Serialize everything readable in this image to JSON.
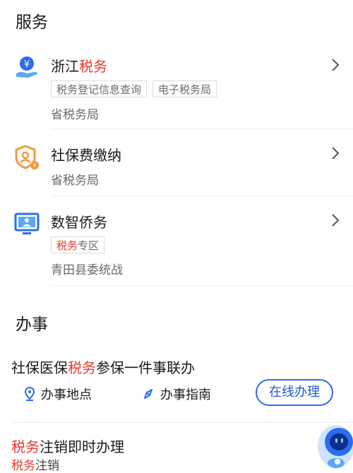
{
  "sections": {
    "services_title": "服务",
    "tasks_title": "办事"
  },
  "services": [
    {
      "name_plain": "浙江",
      "name_highlight": "税务",
      "tags": [
        {
          "highlight": "",
          "text": "税务登记信息查询"
        },
        {
          "highlight": "",
          "text": "电子税务局"
        }
      ],
      "provider": "省税务局",
      "icon": "tax-hand-icon"
    },
    {
      "name_plain": "社保费缴纳",
      "name_highlight": "",
      "tags": [],
      "provider": "省税务局",
      "icon": "social-security-shield-icon"
    },
    {
      "name_plain": "数智侨务",
      "name_highlight": "",
      "tags": [
        {
          "highlight": "税务",
          "text": "专区"
        }
      ],
      "provider": "青田县委统战",
      "icon": "monitor-user-icon"
    }
  ],
  "task1": {
    "title_pre": "社保医保",
    "title_highlight": "税务",
    "title_post": "参保一件事联办",
    "location_label": "办事地点",
    "guide_label": "办事指南",
    "online_label": "在线办理"
  },
  "task2": {
    "title_highlight": "税务",
    "title_post": "注销即时办理",
    "sub_highlight": "税务",
    "sub_post": "注销"
  },
  "colors": {
    "highlight": "#e8382f",
    "accent_blue": "#2d6cf0",
    "icon_orange": "#f09a3e"
  }
}
